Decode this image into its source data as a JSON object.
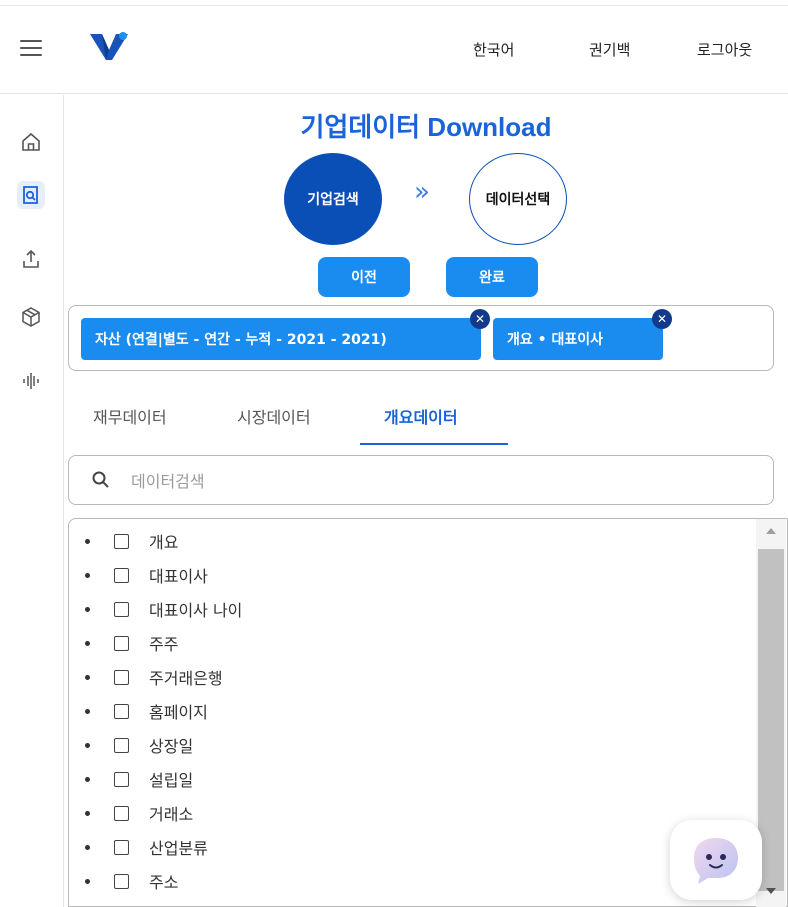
{
  "header": {
    "language": "한국어",
    "user": "권기백",
    "logout": "로그아웃"
  },
  "sidebar": {
    "items": [
      {
        "icon": "home-icon"
      },
      {
        "icon": "search-document-icon",
        "active": true
      },
      {
        "icon": "upload-icon"
      },
      {
        "icon": "cube-icon"
      },
      {
        "icon": "audio-wave-icon"
      }
    ]
  },
  "main": {
    "title": "기업데이터 Download",
    "steps": [
      "기업검색",
      "데이터선택"
    ],
    "prev_button": "이전",
    "done_button": "완료",
    "chips": [
      "자산 (연결|별도 - 연간 - 누적 - 2021 - 2021)",
      "개요 • 대표이사"
    ],
    "tabs": [
      "재무데이터",
      "시장데이터",
      "개요데이터"
    ],
    "active_tab": "개요데이터",
    "search_placeholder": "데이터검색",
    "items": [
      "개요",
      "대표이사",
      "대표이사 나이",
      "주주",
      "주거래은행",
      "홈페이지",
      "상장일",
      "설립일",
      "거래소",
      "산업분류",
      "주소"
    ]
  },
  "colors": {
    "primary": "#1a63d8",
    "button": "#1a8cf0",
    "step_active": "#0a4fb5"
  }
}
